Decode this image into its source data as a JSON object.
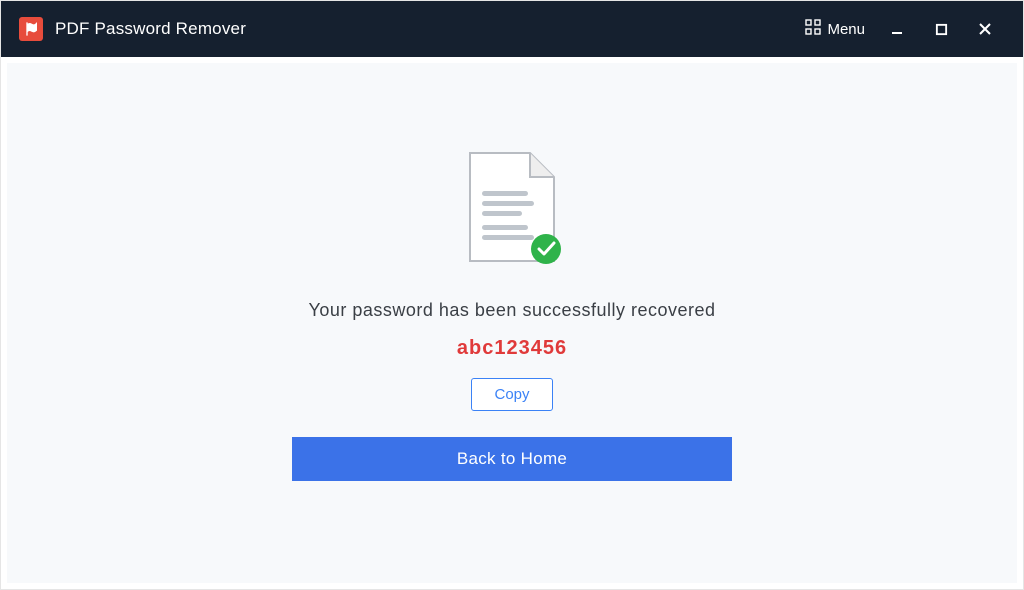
{
  "titlebar": {
    "app_title": "PDF Password Remover",
    "menu_label": "Menu"
  },
  "main": {
    "success_message": "Your password has been successfully recovered",
    "recovered_password": "abc123456",
    "copy_label": "Copy",
    "back_label": "Back to Home"
  }
}
